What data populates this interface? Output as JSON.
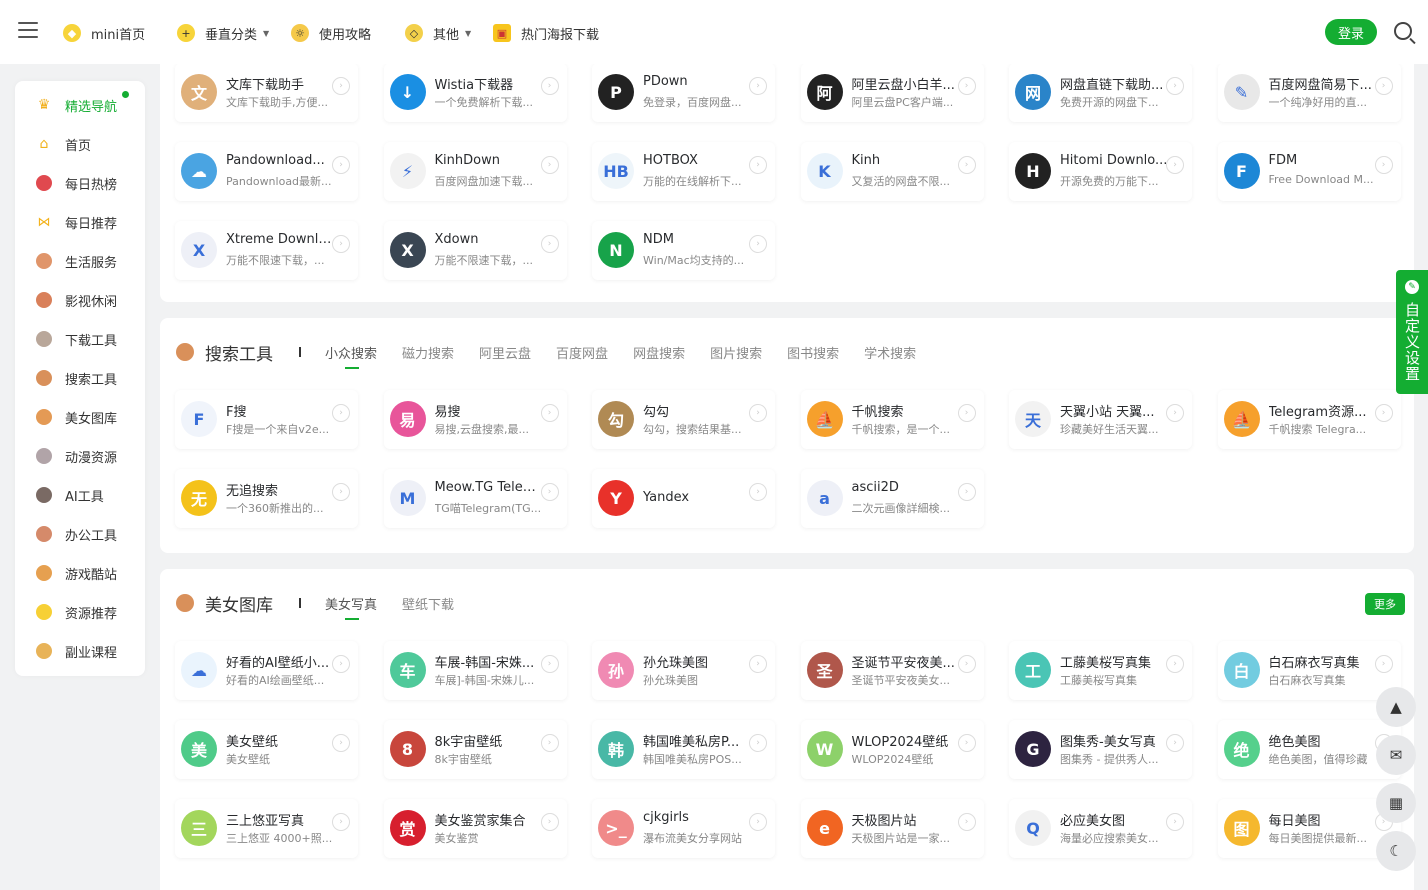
{
  "nav": {
    "items": [
      {
        "label": "mini首页",
        "icon": "gem-icon"
      },
      {
        "label": "垂直分类",
        "icon": "plus-circle-icon",
        "dropdown": true
      },
      {
        "label": "使用攻略",
        "icon": "sun-icon"
      },
      {
        "label": "其他",
        "icon": "diamond-icon",
        "dropdown": true
      },
      {
        "label": "热门海报下载",
        "icon": "poster-icon"
      }
    ],
    "login": "登录"
  },
  "sidebar": {
    "items": [
      {
        "label": "精选导航",
        "icon": "crown-icon",
        "active": true
      },
      {
        "label": "首页",
        "icon": "home-icon"
      },
      {
        "label": "每日热榜",
        "icon": "hot-icon"
      },
      {
        "label": "每日推荐",
        "icon": "bow-icon"
      },
      {
        "label": "生活服务",
        "icon": "bear-icon"
      },
      {
        "label": "影视休闲",
        "icon": "bear-icon"
      },
      {
        "label": "下载工具",
        "icon": "bear-icon"
      },
      {
        "label": "搜索工具",
        "icon": "bear-icon"
      },
      {
        "label": "美女图库",
        "icon": "bear-icon"
      },
      {
        "label": "动漫资源",
        "icon": "bear-icon"
      },
      {
        "label": "AI工具",
        "icon": "bear-icon"
      },
      {
        "label": "办公工具",
        "icon": "bear-icon"
      },
      {
        "label": "游戏酷站",
        "icon": "bear-icon"
      },
      {
        "label": "资源推荐",
        "icon": "smile-icon"
      },
      {
        "label": "副业课程",
        "icon": "bear-icon"
      }
    ]
  },
  "download": {
    "cards": [
      {
        "title": "文库下载助手",
        "desc": "文库下载助手,方便...",
        "color": "#e0b07a",
        "letter": "文"
      },
      {
        "title": "Wistia下载器",
        "desc": "一个免费解析下载...",
        "color": "#1a8fe3",
        "letter": "↓"
      },
      {
        "title": "PDown",
        "desc": "免登录，百度网盘...",
        "color": "#222222",
        "letter": "P"
      },
      {
        "title": "阿里云盘小白羊...",
        "desc": "阿里云盘PC客户端...",
        "color": "#222222",
        "letter": "阿"
      },
      {
        "title": "网盘直链下载助...",
        "desc": "免费开源的网盘下...",
        "color": "#2a84c9",
        "letter": "网"
      },
      {
        "title": "百度网盘简易下...",
        "desc": "一个纯净好用的直...",
        "color": "#e8e8e8",
        "letter": "✎"
      },
      {
        "title": "Pandownload...",
        "desc": "Pandownload最新...",
        "color": "#4aa4e2",
        "letter": "☁"
      },
      {
        "title": "KinhDown",
        "desc": "百度网盘加速下载...",
        "color": "#f2f2f2",
        "letter": "⚡"
      },
      {
        "title": "HOTBOX",
        "desc": "万能的在线解析下...",
        "color": "#eef5fa",
        "letter": "HB"
      },
      {
        "title": "Kinh",
        "desc": "又复活的网盘不限...",
        "color": "#e9f3fb",
        "letter": "K"
      },
      {
        "title": "Hitomi Downlo...",
        "desc": "开源免费的万能下...",
        "color": "#222222",
        "letter": "H"
      },
      {
        "title": "FDM",
        "desc": "Free Download M...",
        "color": "#1d87d6",
        "letter": "F"
      },
      {
        "title": "Xtreme Downlo...",
        "desc": "万能不限速下载，...",
        "color": "#eef0f7",
        "letter": "X"
      },
      {
        "title": "Xdown",
        "desc": "万能不限速下载，...",
        "color": "#3a4653",
        "letter": "X"
      },
      {
        "title": "NDM",
        "desc": "Win/Mac均支持的...",
        "color": "#17a34a",
        "letter": "N"
      }
    ]
  },
  "search": {
    "title": "搜索工具",
    "tabs": [
      "小众搜索",
      "磁力搜索",
      "阿里云盘",
      "百度网盘",
      "网盘搜索",
      "图片搜索",
      "图书搜索",
      "学术搜索"
    ],
    "cards": [
      {
        "title": "F搜",
        "desc": "F搜是一个来自v2e...",
        "color": "#f0f4fb",
        "letter": "F"
      },
      {
        "title": "易搜",
        "desc": "易搜,云盘搜索,最...",
        "color": "#e8559a",
        "letter": "易"
      },
      {
        "title": "勾勾",
        "desc": "勾勾，搜索结果基...",
        "color": "#b08a54",
        "letter": "勾"
      },
      {
        "title": "千帆搜索",
        "desc": "千帆搜索，是一个...",
        "color": "#f6a02c",
        "letter": "⛵"
      },
      {
        "title": "天翼小站 天翼...",
        "desc": "珍藏美好生活天翼...",
        "color": "#f2f2f2",
        "letter": "天"
      },
      {
        "title": "Telegram资源...",
        "desc": "千帆搜索 Telegra...",
        "color": "#f6a02c",
        "letter": "⛵"
      },
      {
        "title": "无追搜索",
        "desc": "一个360新推出的...",
        "color": "#f4c21a",
        "letter": "无"
      },
      {
        "title": "Meow.TG Teleg...",
        "desc": "TG喵Telegram(TG...",
        "color": "#eef0f7",
        "letter": "M"
      },
      {
        "title": "Yandex",
        "desc": "",
        "color": "#e8312a",
        "letter": "Y"
      },
      {
        "title": "ascii2D",
        "desc": "二次元画像詳細検...",
        "color": "#eef0f7",
        "letter": "a"
      }
    ]
  },
  "gallery": {
    "title": "美女图库",
    "tabs": [
      "美女写真",
      "壁纸下载"
    ],
    "more": "更多",
    "cards": [
      {
        "title": "好看的AI壁纸小...",
        "desc": "好看的AI绘画壁纸...",
        "color": "#eaf4fd",
        "letter": "☁"
      },
      {
        "title": "车展-韩国-宋姝...",
        "desc": "车展]-韩国-宋姝儿...",
        "color": "#4fc99a",
        "letter": "车"
      },
      {
        "title": "孙允珠美图",
        "desc": "孙允珠美图",
        "color": "#f08ab3",
        "letter": "孙"
      },
      {
        "title": "圣诞节平安夜美...",
        "desc": "圣诞节平安夜美女...",
        "color": "#b0574b",
        "letter": "圣"
      },
      {
        "title": "工藤美桜写真集",
        "desc": "工藤美桜写真集",
        "color": "#4ac5b5",
        "letter": "工"
      },
      {
        "title": "白石麻衣写真集",
        "desc": "白石麻衣写真集",
        "color": "#72cce0",
        "letter": "白"
      },
      {
        "title": "美女壁纸",
        "desc": "美女壁纸",
        "color": "#4fcb89",
        "letter": "美"
      },
      {
        "title": "8k宇宙壁纸",
        "desc": "8k宇宙壁纸",
        "color": "#c8463c",
        "letter": "8"
      },
      {
        "title": "韩国唯美私房P...",
        "desc": "韩国唯美私房POS...",
        "color": "#48b8a6",
        "letter": "韩"
      },
      {
        "title": "WLOP2024壁纸",
        "desc": "WLOP2024壁纸",
        "color": "#8dd16a",
        "letter": "W"
      },
      {
        "title": "图集秀-美女写真",
        "desc": "图集秀 - 提供秀人...",
        "color": "#2d2340",
        "letter": "G"
      },
      {
        "title": "绝色美图",
        "desc": "绝色美图，值得珍藏",
        "color": "#55d08c",
        "letter": "绝"
      },
      {
        "title": "三上悠亚写真",
        "desc": "三上悠亚 4000+照...",
        "color": "#a3d65c",
        "letter": "三"
      },
      {
        "title": "美女鉴赏家集合",
        "desc": "美女鉴赏",
        "color": "#d71f2e",
        "letter": "赏"
      },
      {
        "title": "cjkgirls",
        "desc": "瀑布流美女分享网站",
        "color": "#f08a8a",
        "letter": ">_"
      },
      {
        "title": "天极图片站",
        "desc": "天极图片站是一家...",
        "color": "#f16522",
        "letter": "e"
      },
      {
        "title": "必应美女图",
        "desc": "海量必应搜索美女...",
        "color": "#f1f1f1",
        "letter": "Q"
      },
      {
        "title": "每日美图",
        "desc": "每日美图提供最新...",
        "color": "#f5b82e",
        "letter": "图"
      }
    ]
  },
  "float": {
    "custom": "自定义设置"
  }
}
